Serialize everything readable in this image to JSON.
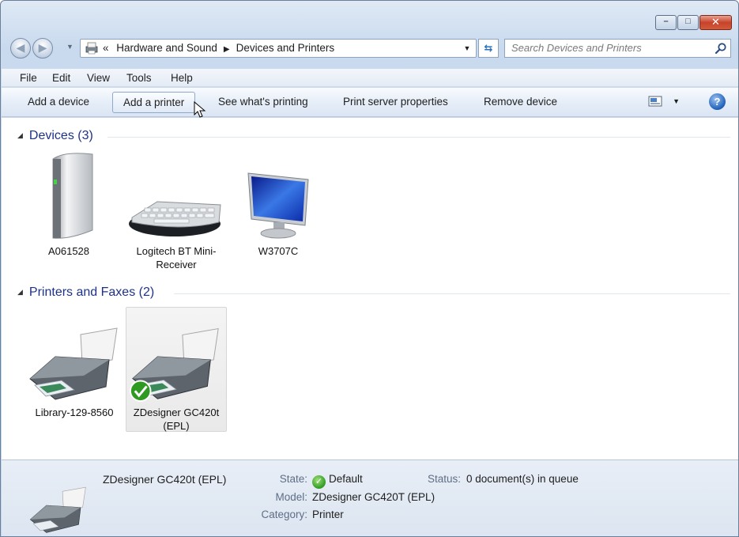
{
  "window": {
    "caption_buttons": {
      "minimize": "–",
      "maximize": "□",
      "close": "✕"
    }
  },
  "address": {
    "overflow": "«",
    "breadcrumb": [
      "Hardware and Sound",
      "Devices and Printers"
    ],
    "separator": "▶",
    "dropdown": "▼",
    "refresh": "⇆"
  },
  "search": {
    "placeholder": "Search Devices and Printers"
  },
  "menu": [
    "File",
    "Edit",
    "View",
    "Tools",
    "Help"
  ],
  "commands": {
    "add_device": "Add a device",
    "add_printer": "Add a printer",
    "see_printing": "See what's printing",
    "print_server": "Print server properties",
    "remove_device": "Remove device",
    "view_dropdown": "▼",
    "help": "?"
  },
  "groups": {
    "devices": {
      "title": "Devices (3)",
      "items": [
        {
          "label": "A061528",
          "icon": "external-drive-icon"
        },
        {
          "label": "Logitech BT Mini-Receiver",
          "icon": "keyboard-icon"
        },
        {
          "label": "W3707C",
          "icon": "monitor-icon"
        }
      ]
    },
    "printers": {
      "title": "Printers and Faxes (2)",
      "items": [
        {
          "label": "Library-129-8560",
          "icon": "printer-icon",
          "default": false
        },
        {
          "label": "ZDesigner GC420t (EPL)",
          "icon": "printer-icon",
          "default": true
        }
      ]
    }
  },
  "details": {
    "name": "ZDesigner GC420t (EPL)",
    "state_label": "State:",
    "state_value": "Default",
    "status_label": "Status:",
    "status_value": "0 document(s) in queue",
    "model_label": "Model:",
    "model_value": "ZDesigner GC420T (EPL)",
    "category_label": "Category:",
    "category_value": "Printer"
  },
  "colors": {
    "group_header": "#1e3287",
    "default_check": "#2f9a22",
    "close_button": "#c8432b"
  }
}
